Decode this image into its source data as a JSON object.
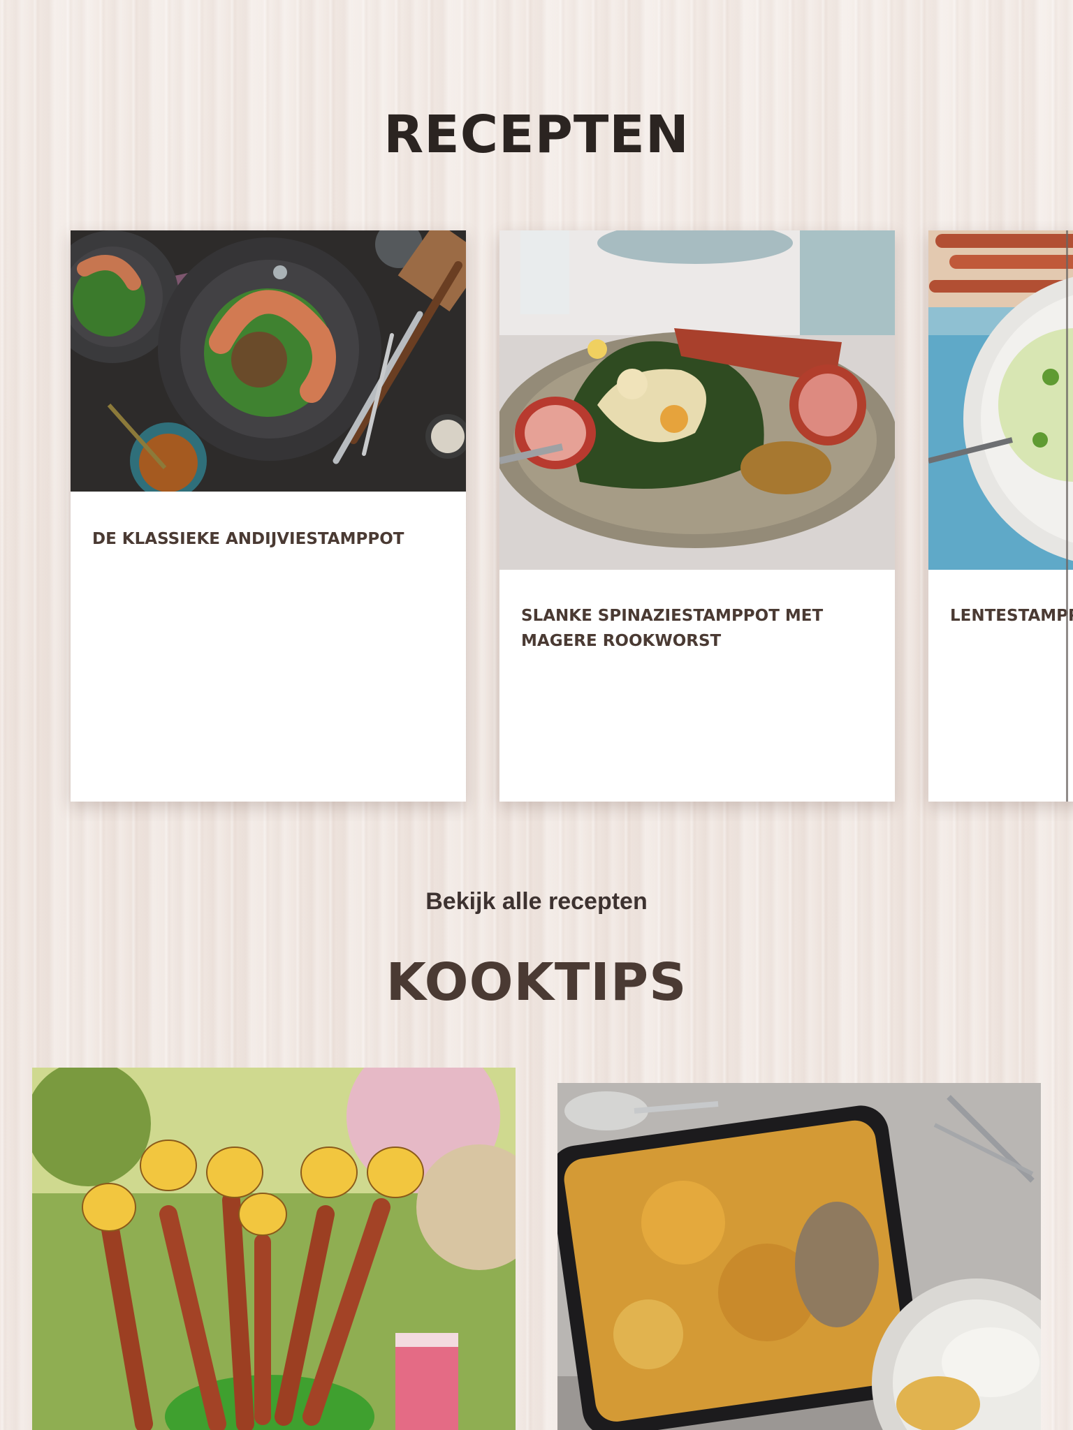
{
  "recipes_section": {
    "title": "Recepten",
    "cards": [
      {
        "title": "De klassieke andijviestamppot",
        "image": "andijviestamppot-photo"
      },
      {
        "title": "Slanke spinaziestamppot met magere rookworst",
        "image": "spinaziestamppot-photo"
      },
      {
        "title": "Lentestamppot met tuinerwten",
        "image": "lentestamppot-photo"
      }
    ],
    "link_label": "Bekijk alle recepten"
  },
  "tips_section": {
    "title": "Kooktips",
    "tiles": [
      {
        "image": "giraffe-sausage-party-photo"
      },
      {
        "image": "oven-casserole-photo"
      }
    ]
  },
  "colors": {
    "heading": "#2b2421",
    "card_title": "#4a3a33",
    "background": "#f1e8e3",
    "card_bg": "#ffffff"
  }
}
